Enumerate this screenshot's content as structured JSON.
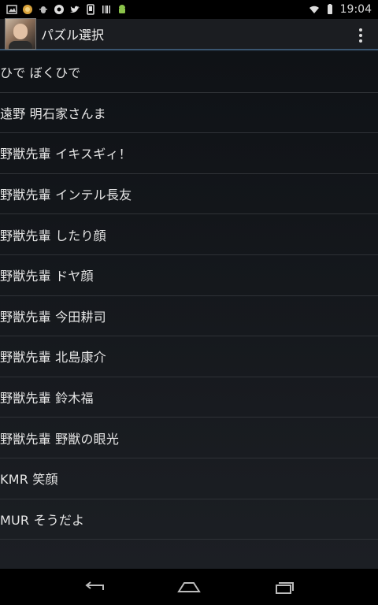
{
  "status_bar": {
    "time": "19:04",
    "icons": [
      "image-icon",
      "coin-icon",
      "bug-icon",
      "recycle-icon",
      "twitter-icon",
      "phone-icon",
      "barcode-icon",
      "android-icon",
      "wifi-icon",
      "battery-icon"
    ]
  },
  "action_bar": {
    "title": "パズル選択",
    "overflow_icon": "overflow-menu-icon"
  },
  "list": {
    "items": [
      {
        "label": "ひで ぼくひで"
      },
      {
        "label": "遠野 明石家さんま"
      },
      {
        "label": "野獣先輩 イキスギィ！"
      },
      {
        "label": "野獣先輩 インテル長友"
      },
      {
        "label": "野獣先輩 したり顔"
      },
      {
        "label": "野獣先輩 ドヤ顔"
      },
      {
        "label": "野獣先輩 今田耕司"
      },
      {
        "label": "野獣先輩 北島康介"
      },
      {
        "label": "野獣先輩 鈴木福"
      },
      {
        "label": "野獣先輩 野獣の眼光"
      },
      {
        "label": "KMR 笑顔"
      },
      {
        "label": "MUR そうだよ"
      }
    ]
  },
  "nav_bar": {
    "icons": [
      "back-icon",
      "home-icon",
      "recents-icon"
    ]
  },
  "colors": {
    "accent": "#3a5570",
    "background": "#111419"
  }
}
